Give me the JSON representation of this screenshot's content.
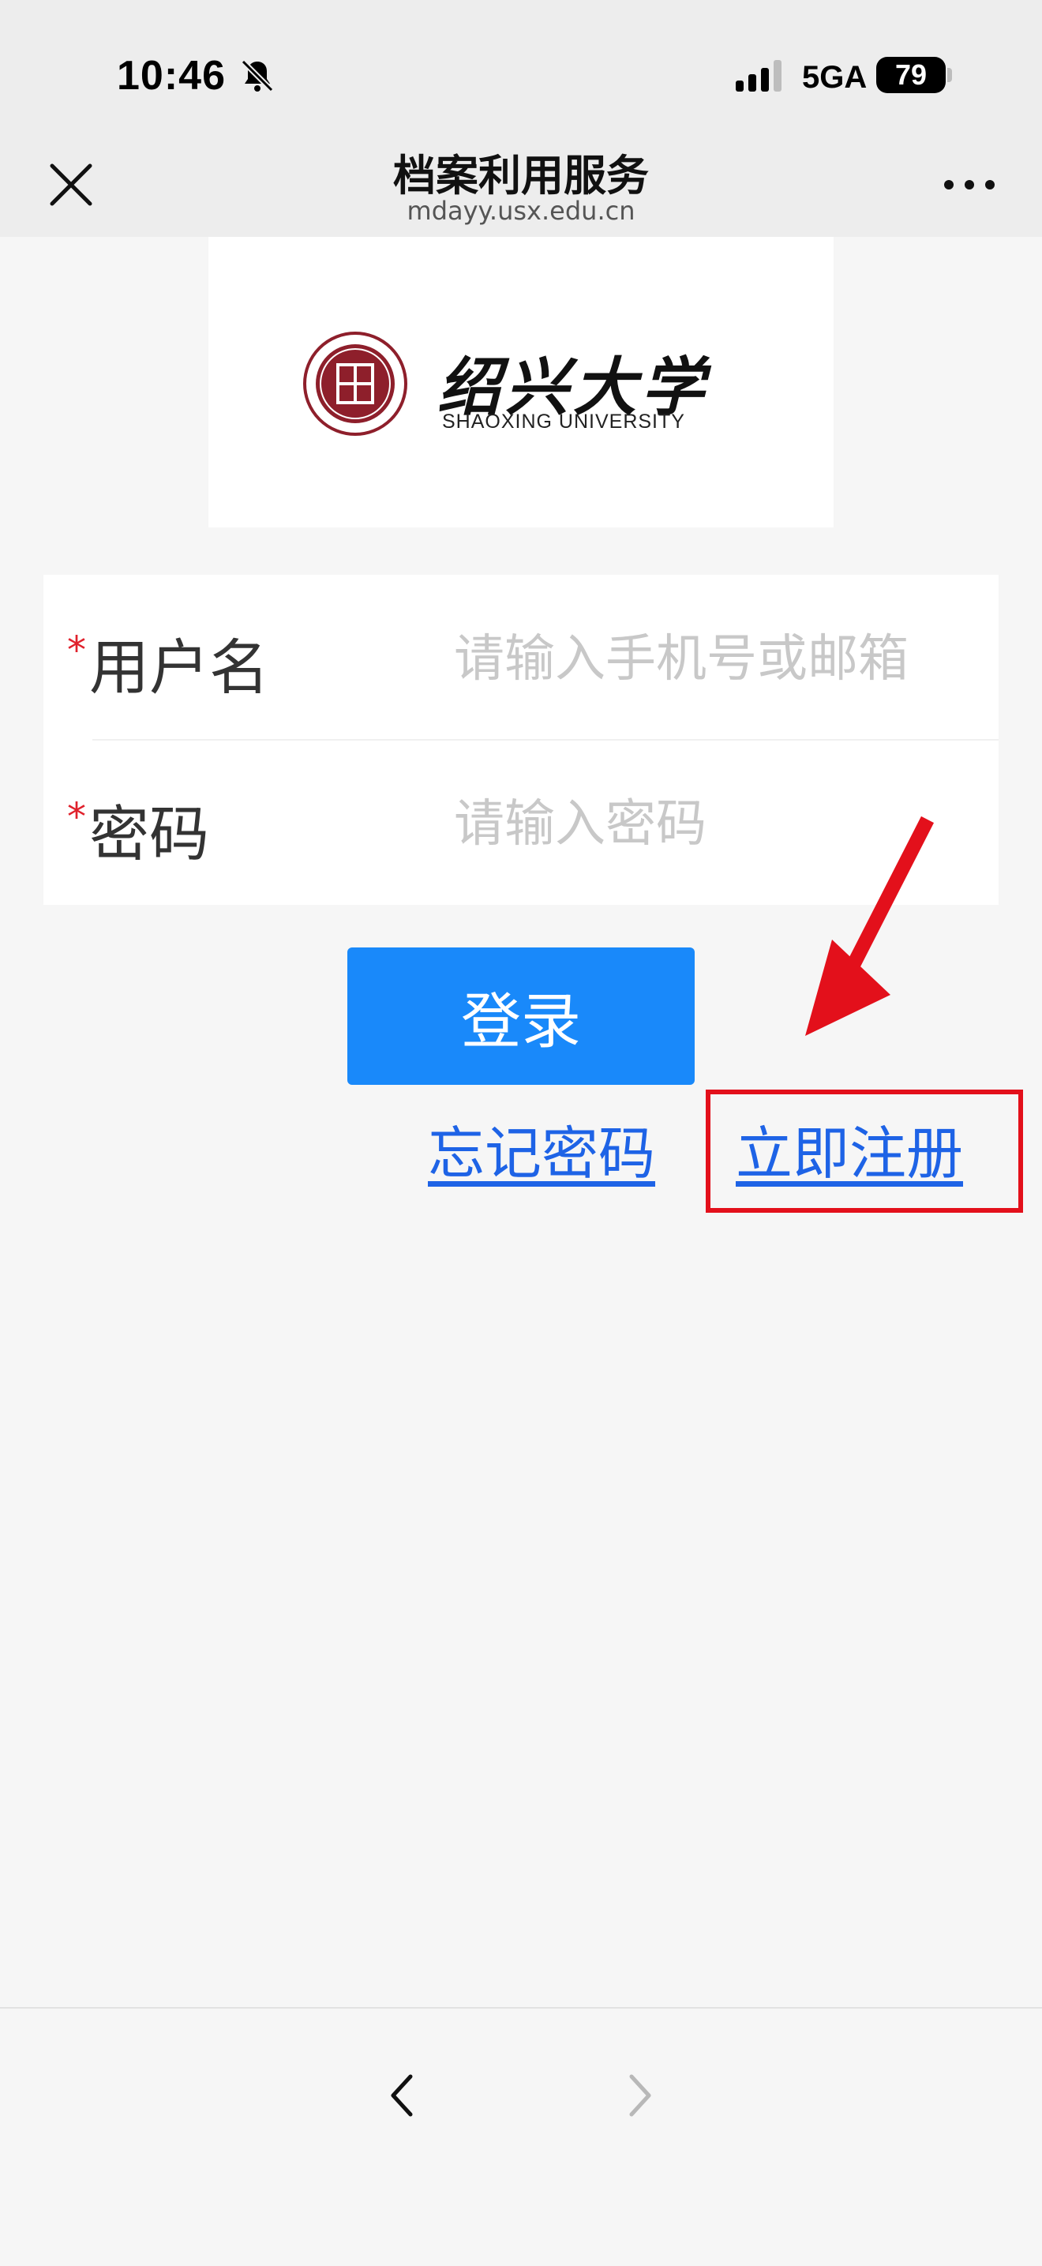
{
  "status_bar": {
    "time": "10:46",
    "network": "5GA",
    "battery": "79",
    "icons": [
      "bell-slash-icon",
      "signal-icon",
      "battery-icon"
    ]
  },
  "nav": {
    "title": "档案利用服务",
    "url": "mdayy.usx.edu.cn",
    "icons": [
      "close-icon",
      "more-icon"
    ]
  },
  "logo": {
    "name_cn": "绍兴大学",
    "name_en": "SHAOXING UNIVERSITY"
  },
  "form": {
    "required_mark": "*",
    "username_label": "用户名",
    "username_placeholder": "请输入手机号或邮箱",
    "password_label": "密码",
    "password_placeholder": "请输入密码"
  },
  "actions": {
    "login": "登录",
    "forgot": "忘记密码",
    "register": "立即注册"
  },
  "colors": {
    "primary": "#1989fa",
    "link": "#1e63e6",
    "annotation": "#e3101b",
    "required": "#e0212c"
  },
  "bottom_nav": {
    "icons": [
      "back-icon",
      "forward-icon"
    ]
  }
}
